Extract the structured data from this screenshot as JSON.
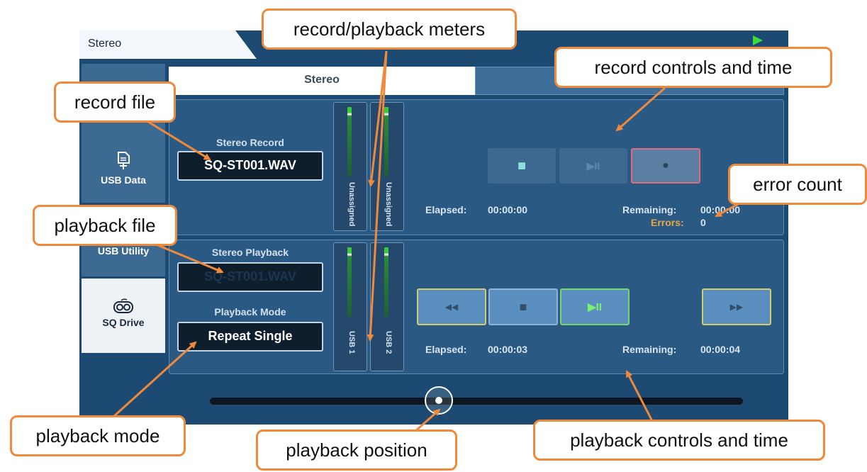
{
  "window": {
    "title_tab": "Stereo"
  },
  "sidebar": {
    "items": [
      {
        "label": "USB Data",
        "icon": "usb-file-icon"
      },
      {
        "label": "USB Utility",
        "icon": "none"
      },
      {
        "label": "SQ Drive",
        "icon": "sq-drive-icon"
      }
    ]
  },
  "tabs": {
    "active": "Stereo"
  },
  "record": {
    "label": "Stereo Record",
    "file": "SQ-ST001.WAV",
    "meters": [
      "Unassigned",
      "Unassigned"
    ],
    "elapsed_label": "Elapsed:",
    "elapsed": "00:00:00",
    "remaining_label": "Remaining:",
    "remaining": "00:00:00",
    "errors_label": "Errors:",
    "errors": "0"
  },
  "playback": {
    "label": "Stereo Playback",
    "file": "SQ-ST001.WAV",
    "mode_label": "Playback Mode",
    "mode": "Repeat Single",
    "meters": [
      "USB 1",
      "USB 2"
    ],
    "elapsed_label": "Elapsed:",
    "elapsed": "00:00:03",
    "remaining_label": "Remaining:",
    "remaining": "00:00:04",
    "position_fraction": 0.43
  },
  "transport_icons": {
    "stop": "■",
    "play_pause": "▶II",
    "record": "●",
    "rewind": "◀◀",
    "fast_forward": "▶▶"
  },
  "callouts": {
    "meters": "record/playback meters",
    "record_controls": "record controls and time",
    "record_file": "record file",
    "error_count": "error count",
    "playback_file": "playback file",
    "playback_mode": "playback mode",
    "playback_position": "playback position",
    "playback_controls": "playback controls and time"
  },
  "colors": {
    "screen_bg": "#1d4a72",
    "callout_border": "#ef8a3c",
    "errors_label": "#e8a640",
    "record_button_border": "#e06a7a",
    "play_button_border": "#75d66a"
  }
}
